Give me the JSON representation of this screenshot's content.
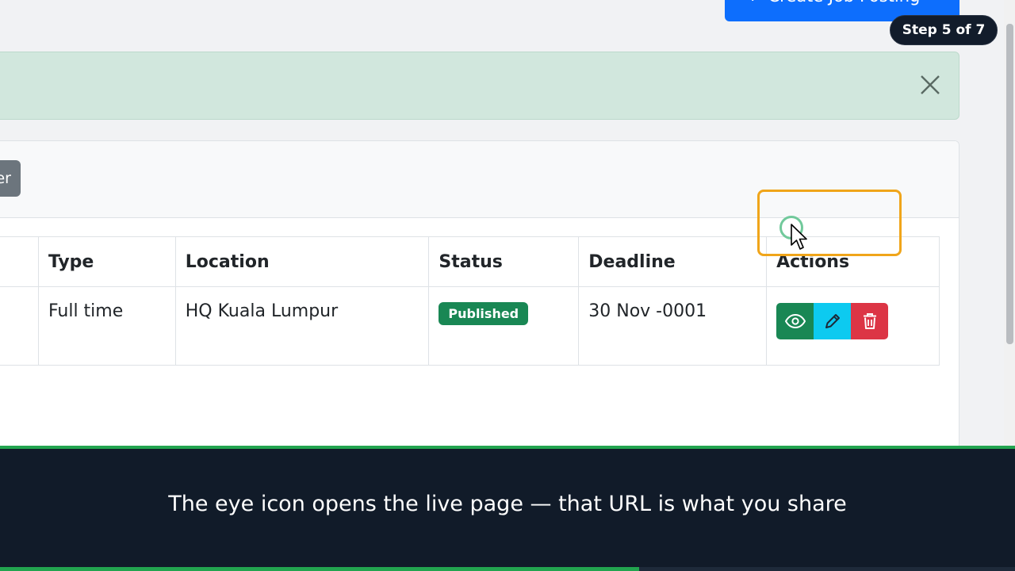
{
  "header": {
    "create_button_label": "Create Job Posting",
    "create_button_icon": "plus-icon"
  },
  "tutorial": {
    "step_label": "Step 5 of 7",
    "step_current": 5,
    "step_total": 7,
    "caption": "The eye icon opens the live page — that URL is what you share",
    "progress_fraction": 0.63
  },
  "alert": {
    "close_icon": "close-icon"
  },
  "toolbar": {
    "filter_button_visible_text": "er"
  },
  "table": {
    "columns": [
      "Type",
      "Location",
      "Status",
      "Deadline",
      "Actions"
    ],
    "rows": [
      {
        "type": "Full time",
        "location": "HQ Kuala Lumpur",
        "status": "Published",
        "deadline": "30 Nov -0001",
        "actions": [
          "eye-icon",
          "pencil-icon",
          "trash-icon"
        ]
      }
    ]
  },
  "colors": {
    "primary": "#0d6efd",
    "success": "#198754",
    "info": "#0dcaf0",
    "danger": "#dc3545",
    "highlight": "#f0a51a",
    "caption_bg": "#111b29",
    "caption_accent": "#22a44f"
  }
}
